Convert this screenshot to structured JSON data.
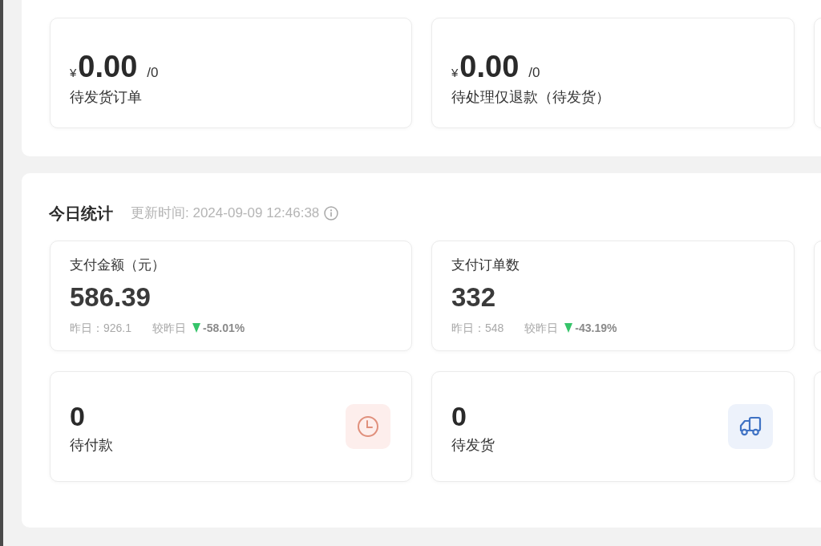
{
  "pending_summary": [
    {
      "currency": "¥",
      "amount": "0.00",
      "count": "/0",
      "label": "待发货订单"
    },
    {
      "currency": "¥",
      "amount": "0.00",
      "count": "/0",
      "label": "待处理仅退款（待发货）"
    }
  ],
  "today_stats": {
    "title": "今日统计",
    "updated": "更新时间: 2024-09-09 12:46:38",
    "metrics": [
      {
        "label": "支付金额（元）",
        "value": "586.39",
        "yesterday": "昨日：926.1",
        "compare_label": "较昨日",
        "decreased": true,
        "change": "-58.01%"
      },
      {
        "label": "支付订单数",
        "value": "332",
        "yesterday": "昨日：548",
        "compare_label": "较昨日",
        "decreased": true,
        "change": "-43.19%"
      }
    ],
    "todo": [
      {
        "kind": "clock",
        "value": "0",
        "label": "待付款"
      },
      {
        "kind": "truck",
        "value": "0",
        "label": "待发货"
      }
    ]
  }
}
